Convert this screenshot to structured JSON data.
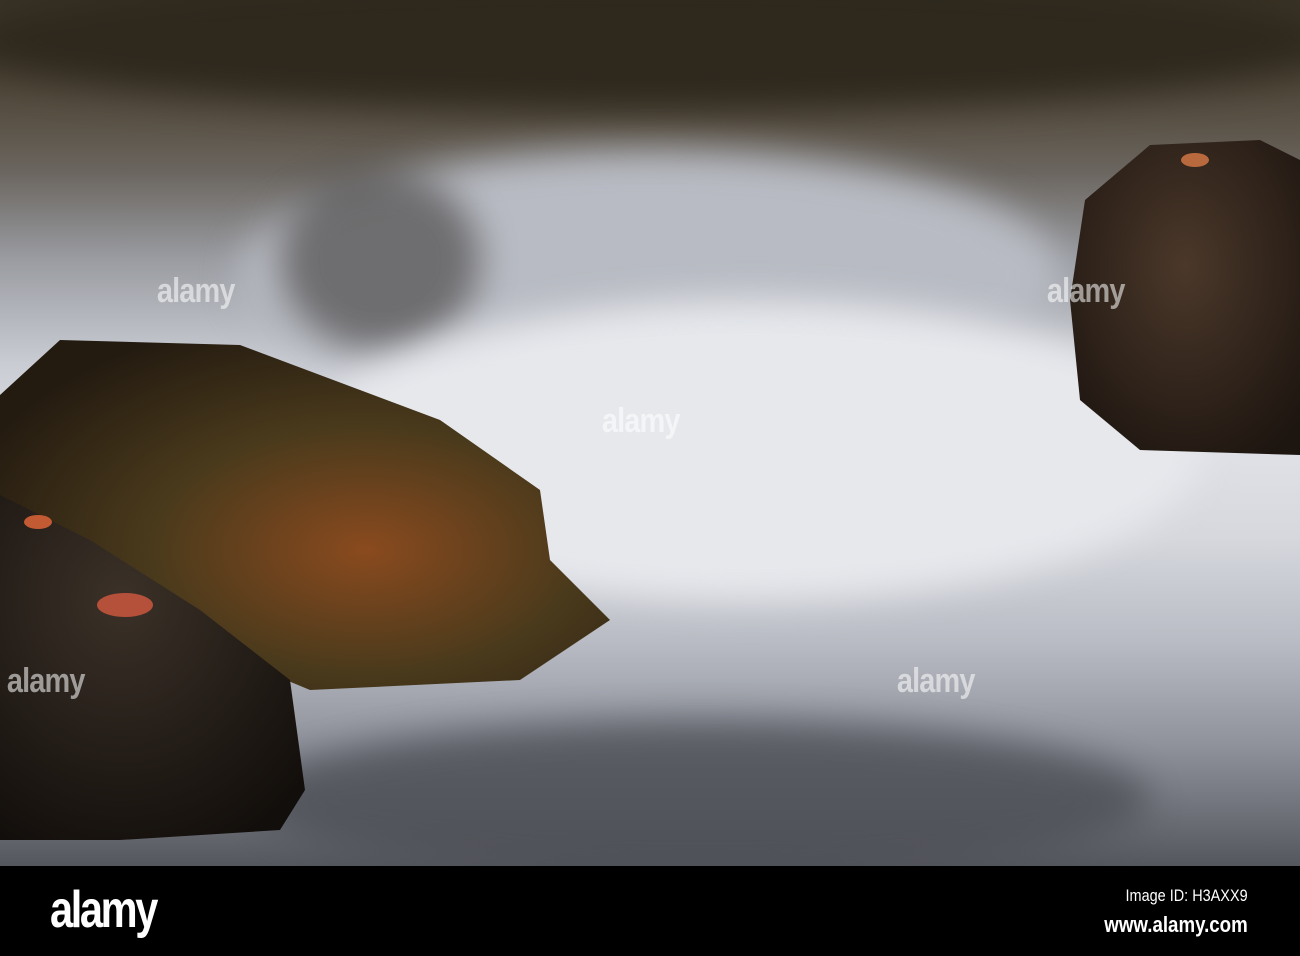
{
  "watermark": "alamy",
  "footer": {
    "logo": "alamy",
    "image_id": "Image ID: H3AXX9",
    "url": "www.alamy.com"
  }
}
